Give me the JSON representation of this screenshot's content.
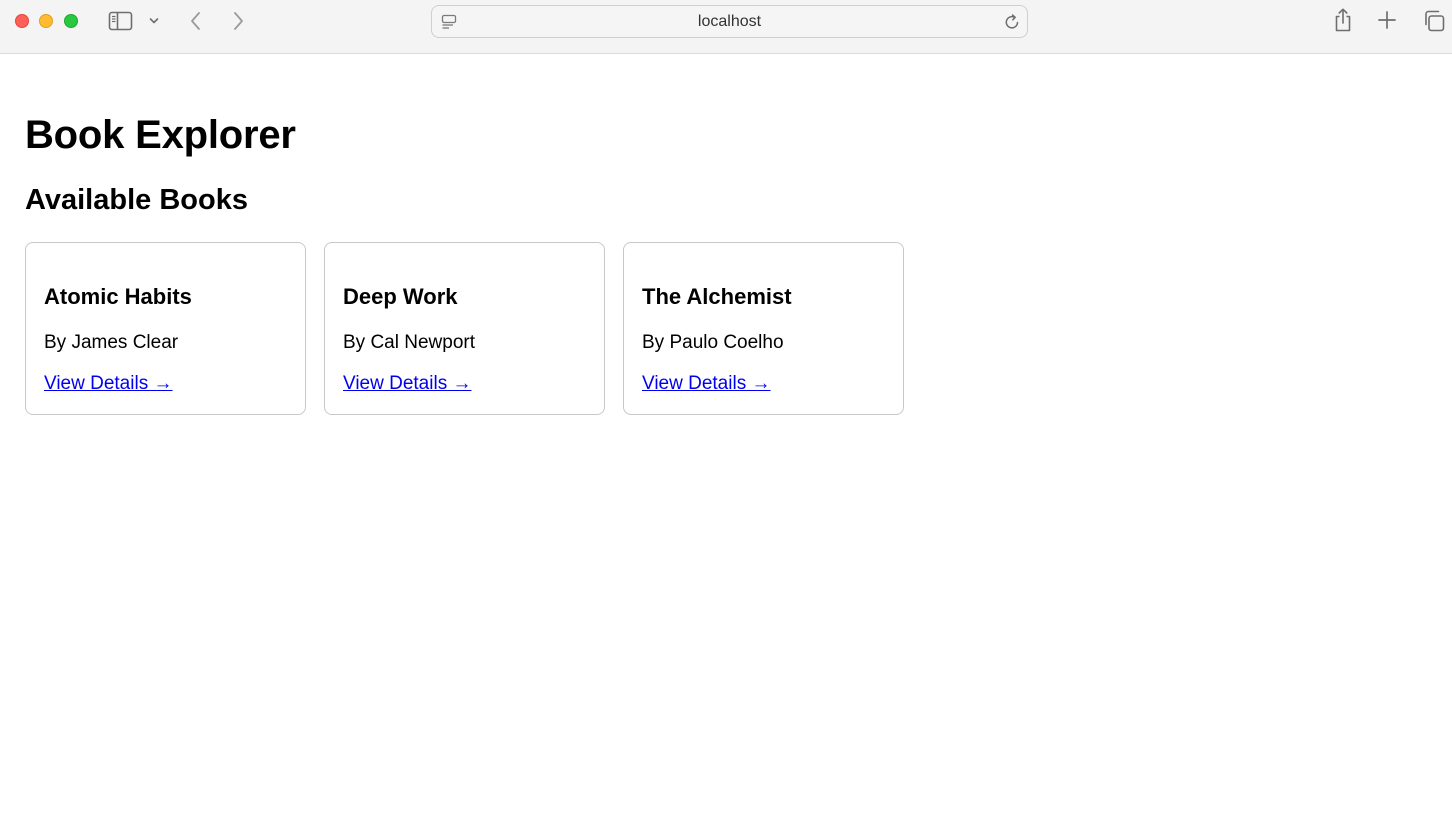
{
  "browser": {
    "url": "localhost",
    "icons": {
      "sidebar": "sidebar-icon",
      "chevron": "chevron-down-icon",
      "back": "back-arrow-icon",
      "forward": "forward-arrow-icon",
      "page": "page-menu-icon",
      "reload": "reload-icon",
      "share": "share-icon",
      "new_tab": "plus-icon",
      "tabs": "tab-overview-icon"
    },
    "colors": {
      "close": "#ff5f57",
      "minimize": "#febc2e",
      "zoom": "#28c840"
    }
  },
  "page": {
    "title": "Book Explorer",
    "section_title": "Available Books",
    "link_color": "#0000ee",
    "books": [
      {
        "title": "Atomic Habits",
        "author": "By James Clear",
        "link": "View Details →"
      },
      {
        "title": "Deep Work",
        "author": "By Cal Newport",
        "link": "View Details →"
      },
      {
        "title": "The Alchemist",
        "author": "By Paulo Coelho",
        "link": "View Details →"
      }
    ]
  }
}
